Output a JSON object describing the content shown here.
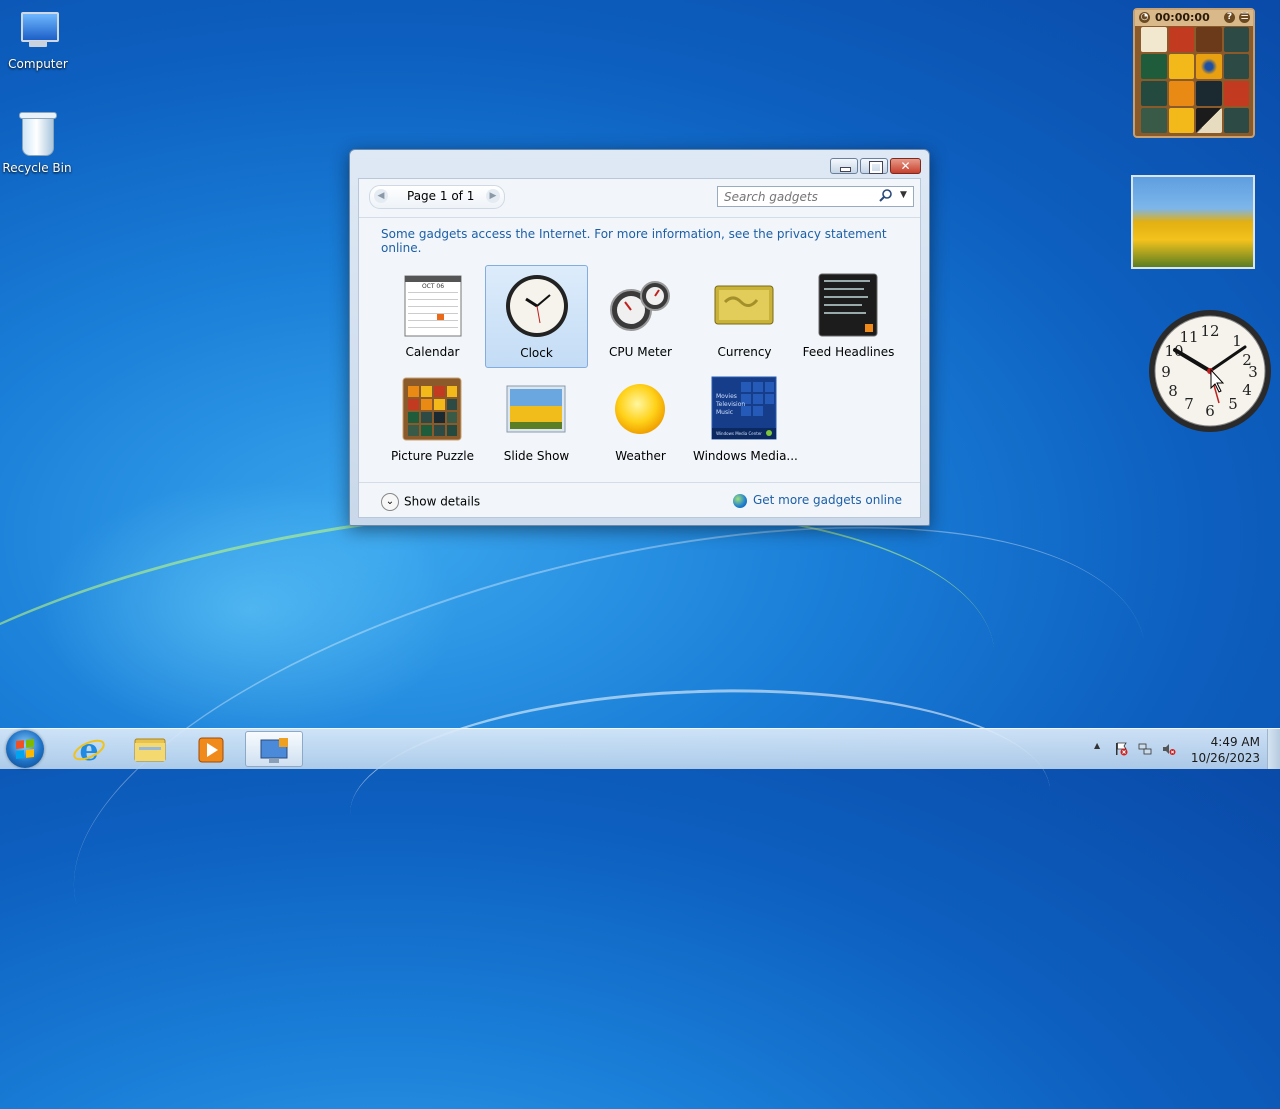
{
  "desktop": {
    "icons": [
      {
        "label": "Computer"
      },
      {
        "label": "Recycle Bin"
      }
    ]
  },
  "gadgets_on_desktop": {
    "puzzle_timer": "00:00:00",
    "puzzle_help": "?",
    "puzzle_menu": "☰"
  },
  "dialog": {
    "page_label": "Page 1 of 1",
    "search_placeholder": "Search gadgets",
    "info_text": "Some gadgets access the Internet.  For more information, see the privacy statement online.",
    "items": [
      {
        "label": "Calendar",
        "icon": "calendar-icon"
      },
      {
        "label": "Clock",
        "icon": "clock-icon",
        "selected": true
      },
      {
        "label": "CPU Meter",
        "icon": "cpu-meter-icon"
      },
      {
        "label": "Currency",
        "icon": "currency-icon"
      },
      {
        "label": "Feed Headlines",
        "icon": "feed-headlines-icon"
      },
      {
        "label": "Picture Puzzle",
        "icon": "picture-puzzle-icon"
      },
      {
        "label": "Slide Show",
        "icon": "slide-show-icon"
      },
      {
        "label": "Weather",
        "icon": "weather-icon"
      },
      {
        "label": "Windows Media...",
        "icon": "windows-media-icon"
      }
    ],
    "calendar_month": "OCT 06",
    "media_menu": [
      "Movies",
      "Television",
      "Music"
    ],
    "media_footer": "Windows Media Center",
    "show_details": "Show details",
    "more_gadgets": "Get more gadgets online",
    "close_glyph": "✕"
  },
  "taskbar": {
    "time": "4:49 AM",
    "date": "10/26/2023",
    "tray_overflow": "▲"
  },
  "colors": {
    "link": "#1c5fa8",
    "selected_bg": "#c3dcf5"
  }
}
